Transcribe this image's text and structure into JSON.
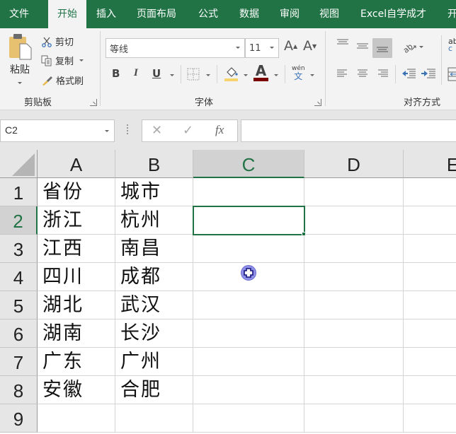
{
  "tabs": [
    {
      "label": "文件",
      "active": false
    },
    {
      "label": "开始",
      "active": true
    },
    {
      "label": "插入",
      "active": false
    },
    {
      "label": "页面布局",
      "active": false
    },
    {
      "label": "公式",
      "active": false
    },
    {
      "label": "数据",
      "active": false
    },
    {
      "label": "审阅",
      "active": false
    },
    {
      "label": "视图",
      "active": false
    },
    {
      "label": "Excel自学成才",
      "active": false
    },
    {
      "label": "开",
      "active": false
    }
  ],
  "ribbon": {
    "clipboard": {
      "label": "剪贴板",
      "paste": "粘贴",
      "cut": "剪切",
      "copy": "复制",
      "format_painter": "格式刷"
    },
    "font": {
      "label": "字体",
      "font_name": "等线",
      "font_size": "11",
      "bold": "B",
      "italic": "I",
      "underline": "U",
      "grow_font": "A",
      "shrink_font": "A",
      "font_color_letter": "A",
      "phonetic_top": "wén",
      "phonetic_bottom": "文",
      "fill_color": "#f7d36b",
      "font_color": "#7b0000"
    },
    "alignment": {
      "label": "对齐方式",
      "wrap_partial": "ab",
      "wrap_partial2": "c"
    }
  },
  "formula_bar": {
    "name_box": "C2",
    "cancel": "✕",
    "enter": "✓",
    "fx": "fx",
    "formula": ""
  },
  "sheet": {
    "columns": [
      "A",
      "B",
      "C",
      "D",
      "E"
    ],
    "selected_column": "C",
    "rows": [
      "1",
      "2",
      "3",
      "4",
      "5",
      "6",
      "7",
      "8",
      "9"
    ],
    "selected_row": "2",
    "active_cell": "C2",
    "data": [
      [
        "省份",
        "城市"
      ],
      [
        "浙江",
        "杭州"
      ],
      [
        "江西",
        "南昌"
      ],
      [
        "四川",
        "成都"
      ],
      [
        "湖北",
        "武汉"
      ],
      [
        "湖南",
        "长沙"
      ],
      [
        "广东",
        "广州"
      ],
      [
        "安徽",
        "合肥"
      ],
      [
        "",
        ""
      ]
    ]
  },
  "colors": {
    "accent": "#217346",
    "cursor": "#8f8fe8"
  }
}
